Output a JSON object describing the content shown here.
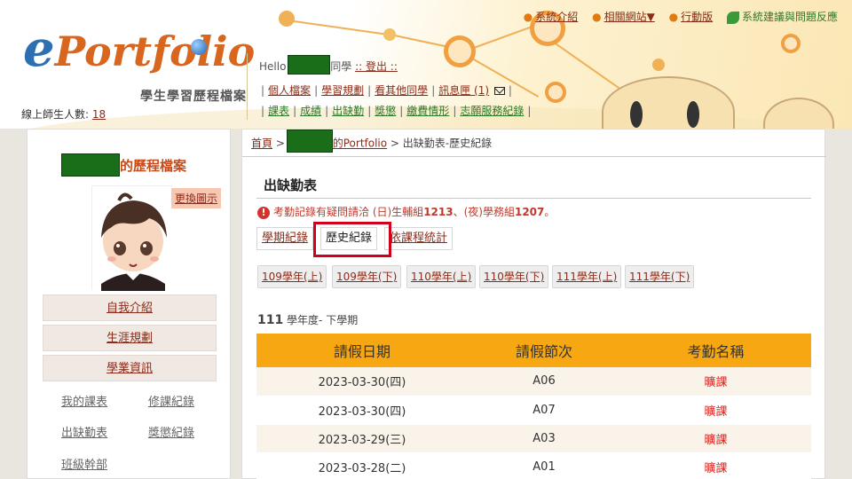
{
  "header": {
    "logo_e": "e",
    "logo_rest": "Portfolio",
    "tagline": "學生學習歷程檔案",
    "online_label": "線上師生人數:",
    "online_count": "18",
    "hello_prefix": "Hello",
    "hello_suffix": "同學",
    "logout": ":: 登出 ::",
    "nav_row1": [
      "個人檔案",
      "學習規劃",
      "看其他同學",
      "訊息匣 (1)"
    ],
    "nav_row2": [
      "課表",
      "成績",
      "出缺勤",
      "獎懲",
      "繳費情形",
      "志願服務紀錄"
    ],
    "top_links": [
      "系統介紹",
      "相關網站▼",
      "行動版"
    ],
    "feedback": "系統建議與問題反應"
  },
  "sidebar": {
    "title_suffix": "的歷程檔案",
    "change_pic": "更換圖示",
    "buttons": [
      "自我介紹",
      "生涯規劃",
      "學業資訊"
    ],
    "links": [
      "我的課表",
      "修課紀錄",
      "出缺勤表",
      "獎懲紀錄",
      "班級幹部"
    ]
  },
  "main": {
    "breadcrumb_home": "首頁",
    "breadcrumb_portfolio": "的Portfolio",
    "breadcrumb_rest": " > 出缺勤表-歷史紀錄",
    "title": "出缺勤表",
    "notice_a": "考勤記錄有疑問請洽 (日)生輔組",
    "notice_b": "1213",
    "notice_c": "、(夜)學務組",
    "notice_d": "1207",
    "notice_e": "。",
    "tabs": [
      "學期紀錄",
      "歷史紀錄",
      "依課程統計"
    ],
    "years": [
      "109學年(上)",
      "109學年(下)",
      "110學年(上)",
      "110學年(下)",
      "111學年(上)",
      "111學年(下)"
    ],
    "semester_year": "111",
    "semester_label": " 學年度- 下學期",
    "table_headers": [
      "請假日期",
      "請假節次",
      "考勤名稱"
    ],
    "rows": [
      {
        "date": "2023-03-30(四)",
        "period": "A06",
        "type": "曠課"
      },
      {
        "date": "2023-03-30(四)",
        "period": "A07",
        "type": "曠課"
      },
      {
        "date": "2023-03-29(三)",
        "period": "A03",
        "type": "曠課"
      },
      {
        "date": "2023-03-28(二)",
        "period": "A01",
        "type": "曠課"
      }
    ]
  }
}
